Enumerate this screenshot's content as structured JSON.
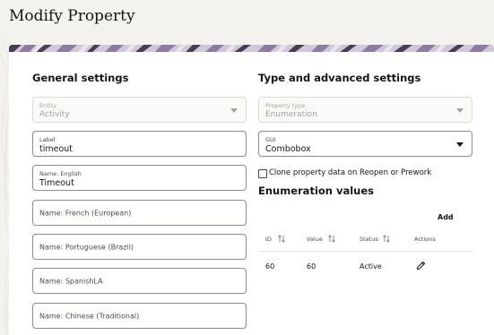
{
  "page": {
    "title": "Modify Property"
  },
  "general": {
    "title": "General settings",
    "entity": {
      "label": "Entity",
      "value": "Activity"
    },
    "label_field": {
      "label": "Label",
      "value": "timeout"
    },
    "name_english": {
      "label": "Name: English",
      "value": "Timeout"
    },
    "name_french": {
      "placeholder": "Name: French (European)"
    },
    "name_portuguese": {
      "placeholder": "Name: Portuguese (Brazil)"
    },
    "name_spanish": {
      "placeholder": "Name: SpanishLA"
    },
    "name_chinese": {
      "placeholder": "Name: Chinese (Traditional)"
    }
  },
  "advanced": {
    "title": "Type and advanced settings",
    "property_type": {
      "label": "Property type",
      "value": "Enumeration"
    },
    "gui": {
      "label": "GUI",
      "value": "Combobox"
    },
    "clone_checkbox": {
      "label": "Clone property data on Reopen or Prework",
      "checked": false
    },
    "enum_title": "Enumeration values",
    "add_label": "Add",
    "table": {
      "headers": {
        "id": "ID",
        "value": "Value",
        "status": "Status",
        "actions": "Actions"
      },
      "rows": [
        {
          "id": "60",
          "value": "60",
          "status": "Active",
          "action_icon": "pencil-icon"
        }
      ]
    }
  }
}
